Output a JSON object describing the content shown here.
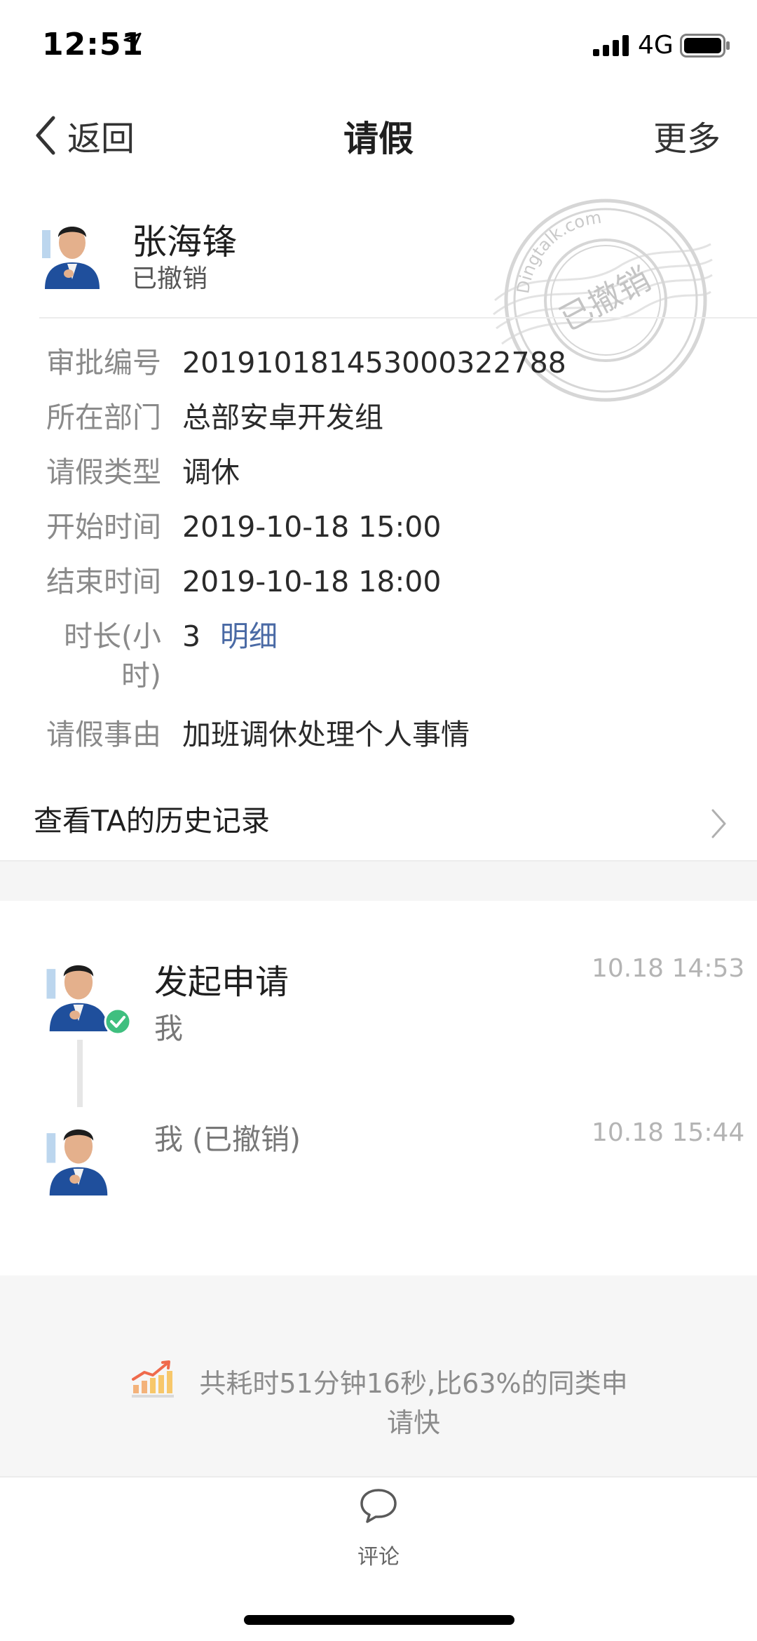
{
  "status_bar": {
    "time": "12:51",
    "network": "4G",
    "icons": [
      "location-arrow-icon",
      "signal-icon",
      "battery-icon"
    ]
  },
  "nav": {
    "back_label": "返回",
    "title": "请假",
    "more_label": "更多"
  },
  "applicant": {
    "name": "张海锋",
    "status": "已撤销"
  },
  "stamp": {
    "domain": "Dingtalk.com",
    "label": "已撤销"
  },
  "details": [
    {
      "label": "审批编号",
      "value": "201910181453000322788"
    },
    {
      "label": "所在部门",
      "value": "总部安卓开发组"
    },
    {
      "label": "请假类型",
      "value": "调休"
    },
    {
      "label": "开始时间",
      "value": "2019-10-18 15:00"
    },
    {
      "label": "结束时间",
      "value": "2019-10-18 18:00"
    },
    {
      "label_line1": "时长(小",
      "label_line2": "时)",
      "value": "3",
      "link": "明细"
    },
    {
      "label": "请假事由",
      "value": "加班调休处理个人事情"
    }
  ],
  "history_link": "查看TA的历史记录",
  "timeline": [
    {
      "title": "发起申请",
      "user": "我",
      "time": "10.18 14:53"
    },
    {
      "title": "我 (已撤销)",
      "time": "10.18 15:44"
    }
  ],
  "summary": {
    "text": "共耗时51分钟16秒,比63%的同类申请快"
  },
  "bottom": {
    "comment_label": "评论"
  },
  "colors": {
    "accent_link": "#4a6aa5",
    "check_green": "#3fbf7f",
    "summary_bg": "#f6f6f6"
  }
}
